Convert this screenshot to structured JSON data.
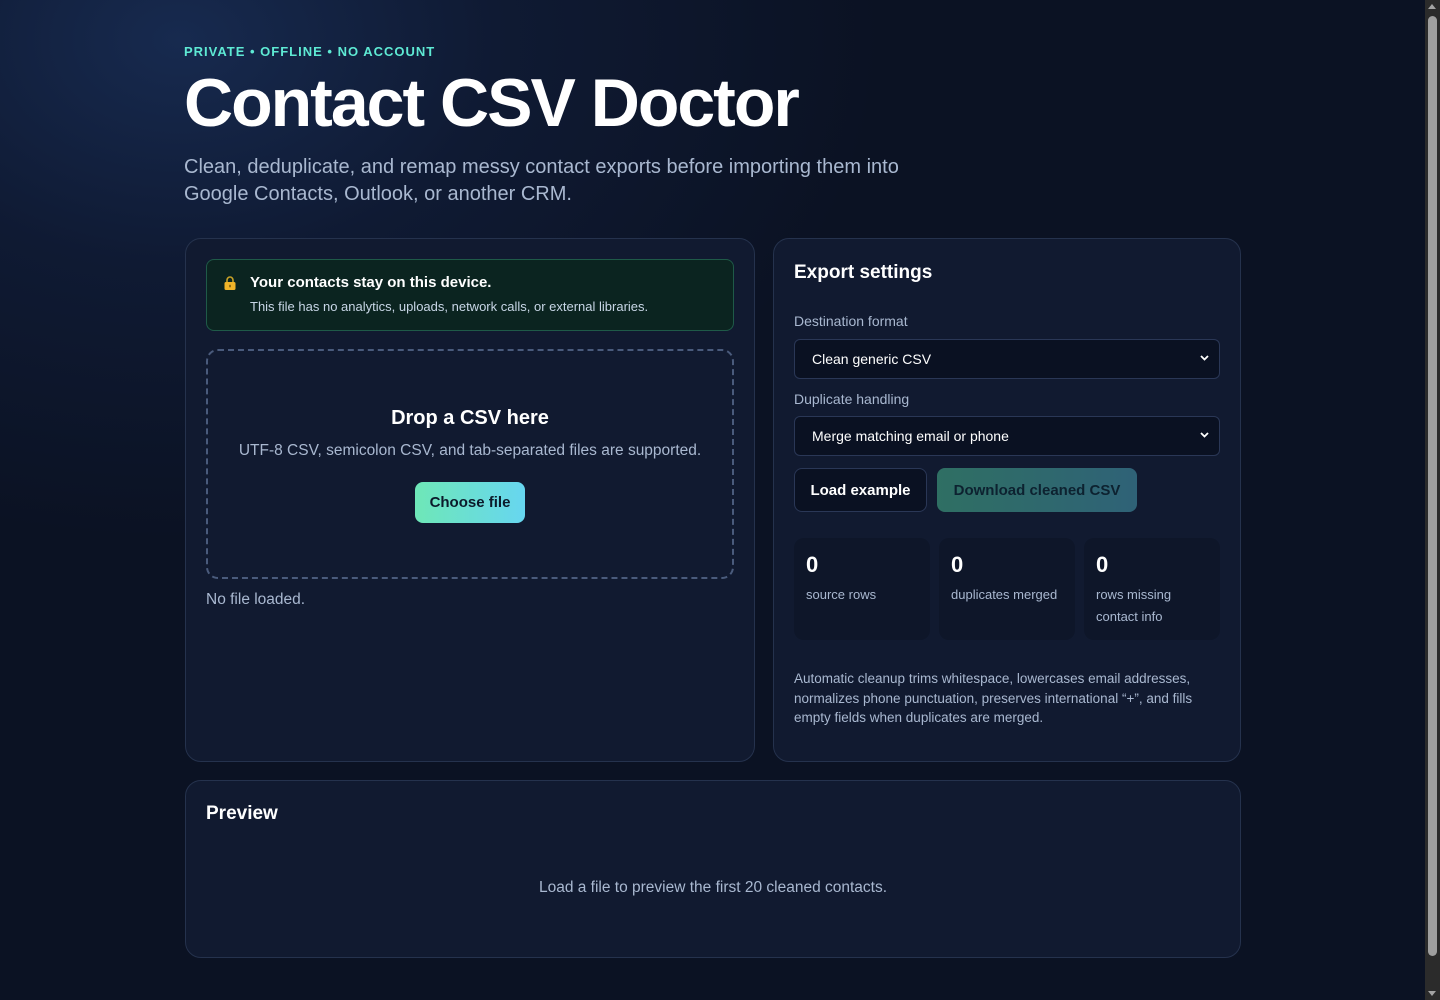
{
  "header": {
    "eyebrow": "PRIVATE • OFFLINE • NO ACCOUNT",
    "title": "Contact CSV Doctor",
    "subtitle": "Clean, deduplicate, and remap messy contact exports before importing them into Google Contacts, Outlook, or another CRM."
  },
  "upload": {
    "privacy": {
      "icon": "lock-icon",
      "title": "Your contacts stay on this device.",
      "text": "This file has no analytics, uploads, network calls, or external libraries."
    },
    "dropzone": {
      "title": "Drop a CSV here",
      "text": "UTF-8 CSV, semicolon CSV, and tab-separated files are supported.",
      "button_label": "Choose file"
    },
    "status": "No file loaded."
  },
  "export": {
    "title": "Export settings",
    "destination": {
      "label": "Destination format",
      "selected": "Clean generic CSV"
    },
    "duplicates": {
      "label": "Duplicate handling",
      "selected": "Merge matching email or phone"
    },
    "buttons": {
      "load_example": "Load example",
      "download": "Download cleaned CSV"
    },
    "stats": [
      {
        "value": "0",
        "label": "source rows"
      },
      {
        "value": "0",
        "label": "duplicates merged"
      },
      {
        "value": "0",
        "label": "rows missing contact info"
      }
    ],
    "note": "Automatic cleanup trims whitespace, lowercases email addresses, normalizes phone punctuation, preserves international “+”, and fills empty fields when duplicates are merged."
  },
  "preview": {
    "title": "Preview",
    "empty_text": "Load a file to preview the first 20 cleaned contacts."
  },
  "colors": {
    "accent": "#5eead4",
    "button_gradient_start": "#6ee7b7",
    "button_gradient_end": "#67d6f0",
    "background": "#0b1223",
    "card": "#111a30"
  }
}
